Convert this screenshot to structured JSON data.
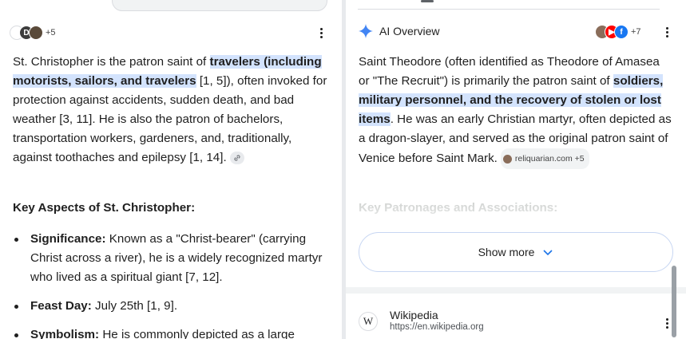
{
  "left": {
    "avatar_count": "+5",
    "paragraph": {
      "before": "St. Christopher is the patron saint of ",
      "highlight": "travelers (including motorists, sailors, and travelers",
      "after1": " [1, 5]), often invoked for protection against accidents, sudden death, and bad weather [3, 11]. He is also the patron of bachelors, transportation workers, gardeners, and, traditionally, against toothaches and epilepsy [1, 14].",
      "chip_icon": "link-icon"
    },
    "heading": "Key Aspects of St. Christopher:",
    "bullets": [
      {
        "term": "Significance:",
        "text": " Known as a \"Christ-bearer\" (carrying Christ across a river), he is a widely recognized martyr who lived as a spiritual giant [7, 12]."
      },
      {
        "term": "Feast Day:",
        "text": " July 25th [1, 9]."
      },
      {
        "term": "Symbolism:",
        "text": " He is commonly depicted as a large"
      }
    ]
  },
  "right": {
    "ai_title": "AI Overview",
    "avatar_count": "+7",
    "paragraph": {
      "before": "Saint Theodore (often identified as Theodore of Amasea or \"The Recruit\") is primarily the patron saint of ",
      "highlight": "soldiers, military personnel, and the recovery of stolen or lost items",
      "after": ". He was an early Christian martyr, often depicted as a dragon-slayer, and served as the original patron saint of Venice before Saint Mark.",
      "source_chip": "reliquarian.com +5"
    },
    "faded_heading": "Key Patronages and Associations:",
    "show_more": "Show more",
    "source": {
      "logo": "W",
      "name": "Wikipedia",
      "url": "https://en.wikipedia.org"
    }
  },
  "colors": {
    "highlight": "#d3e3fd",
    "gemini_blue": "#4285f4",
    "youtube_red": "#ff0000",
    "facebook_blue": "#1877f2"
  }
}
